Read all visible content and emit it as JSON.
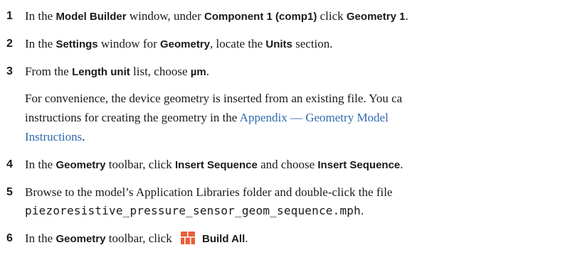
{
  "steps": [
    {
      "number": "1",
      "parts": [
        "In the ",
        "Model Builder",
        " window, under ",
        "Component 1 (comp1)",
        " click ",
        "Geometry 1",
        "."
      ]
    },
    {
      "number": "2",
      "parts": [
        "In the ",
        "Settings",
        " window for ",
        "Geometry",
        ", locate the ",
        "Units",
        " section."
      ]
    },
    {
      "number": "3",
      "parts": [
        "From the ",
        "Length unit",
        " list, choose ",
        "µm",
        "."
      ]
    },
    {
      "number": "4",
      "parts": [
        "In the ",
        "Geometry",
        " toolbar, click ",
        "Insert Sequence",
        " and choose ",
        "Insert Sequence",
        "."
      ]
    },
    {
      "number": "5",
      "line1": "Browse to the model’s Application Libraries folder and double-click the file",
      "filename": "piezoresistive_pressure_sensor_geom_sequence.mph",
      "period": "."
    },
    {
      "number": "6",
      "parts": [
        "In the ",
        "Geometry",
        " toolbar, click ",
        "Build All",
        "."
      ],
      "icon": "build-all-icon"
    }
  ],
  "note": {
    "line1": "For convenience, the device geometry is inserted from an existing file. You ca",
    "line2_text": "instructions for creating the geometry in the ",
    "link_line1": "Appendix — Geometry Model",
    "link_line2": "Instructions",
    "end": "."
  },
  "colors": {
    "link": "#2f6ab0",
    "icon": "#e8603c"
  }
}
